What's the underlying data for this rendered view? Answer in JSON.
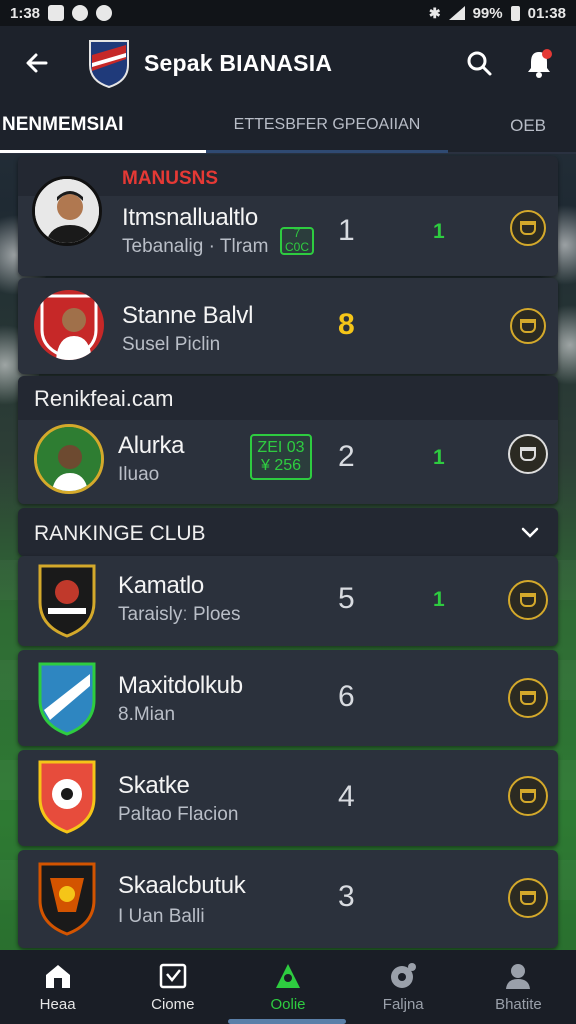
{
  "status_bar": {
    "time_left": "1:38",
    "battery": "99%",
    "time_right": "01:38"
  },
  "app": {
    "title": "Sepak BIANASIA"
  },
  "tabs": [
    "NENMEMSIAI",
    "ETTESBFER GPEOAIIAN",
    "OEB"
  ],
  "sections": {
    "first": "MANUSNS",
    "second": "Renikfeai.cam",
    "third": "RANKINGE CLUB"
  },
  "players": [
    {
      "name": "Itmsnallualtlo",
      "sub": "Tebanalig · Tlram",
      "rank": "1",
      "move": "1",
      "badge": "7 C0C"
    },
    {
      "name": "Stanne Balvl",
      "sub": "Susel Piclin",
      "rank": "8",
      "move": "",
      "badge": ""
    },
    {
      "name": "Alurka",
      "sub": "Iluao",
      "rank": "2",
      "move": "1",
      "badge": "ZEI 03\n¥ 256"
    }
  ],
  "clubs": [
    {
      "name": "Kamatlo",
      "sub": "Taraislyː Ploes",
      "rank": "5",
      "move": "1",
      "color": "#c0392b"
    },
    {
      "name": "Maxitdolkub",
      "sub": "8.Mian",
      "rank": "6",
      "move": "",
      "color": "#2e86c1"
    },
    {
      "name": "Skatke",
      "sub": "Paltao Flacion",
      "rank": "4",
      "move": "",
      "color": "#e74c3c"
    },
    {
      "name": "Skaalcbutuk",
      "sub": "I Uan Balli",
      "rank": "3",
      "move": "",
      "color": "#d35400"
    }
  ],
  "bottom_nav": [
    "Heaa",
    "Ciome",
    "Oolie",
    "Faljna",
    "Bhatite"
  ],
  "colors": {
    "accent_green": "#2ecc40",
    "gold": "#f5c518",
    "card": "#2b313c"
  }
}
